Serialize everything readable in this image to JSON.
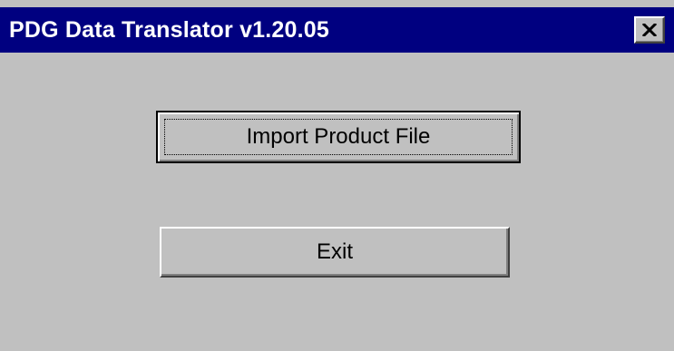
{
  "window": {
    "title": "PDG Data Translator v1.20.05",
    "close_icon": "close-icon"
  },
  "buttons": {
    "import_label": "Import Product File",
    "exit_label": "Exit"
  },
  "colors": {
    "titlebar": "#000080",
    "title_text": "#ffffff",
    "face": "#c0c0c0"
  }
}
